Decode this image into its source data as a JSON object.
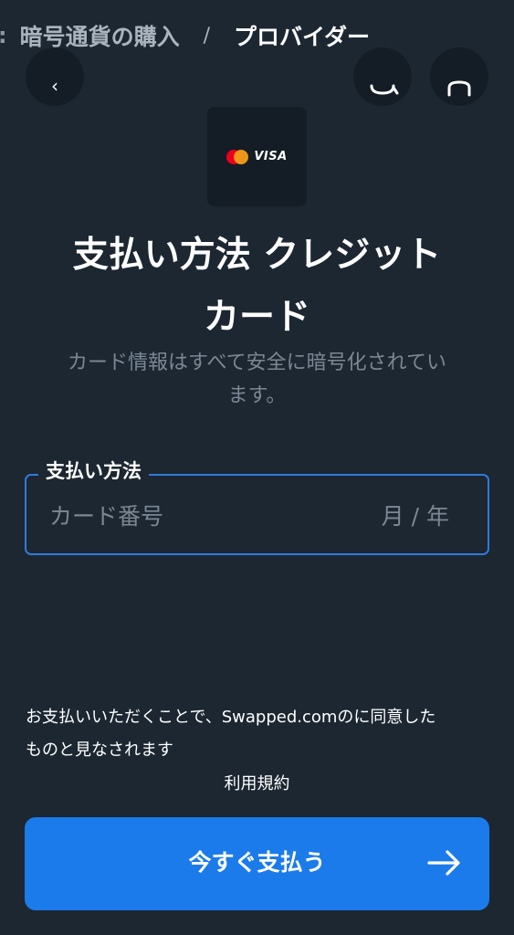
{
  "breadcrumb": {
    "parent": "暗号通貨の購入",
    "separator": "/",
    "current": "プロバイダー"
  },
  "card_logo": {
    "brand_text": "VISA"
  },
  "title": {
    "line1": "支払い方法 クレジット",
    "line2": "カード"
  },
  "subtitle": {
    "line1": "カード情報はすべて安全に暗号化されてい",
    "line2": "ます。"
  },
  "payment_field": {
    "legend": "支払い方法",
    "card_number_placeholder": "カード番号",
    "expiry_placeholder": "月 / 年"
  },
  "consent": {
    "line1": "お支払いいただくことで、Swapped.comのに同意した",
    "line2": "ものと見なされます",
    "terms_link": "利用規約"
  },
  "pay_button": {
    "label": "今すぐ支払う"
  },
  "colors": {
    "background": "#1c2731",
    "accent": "#1c7bea",
    "field_border": "#2f7bd8",
    "muted_text": "#7b8794"
  }
}
